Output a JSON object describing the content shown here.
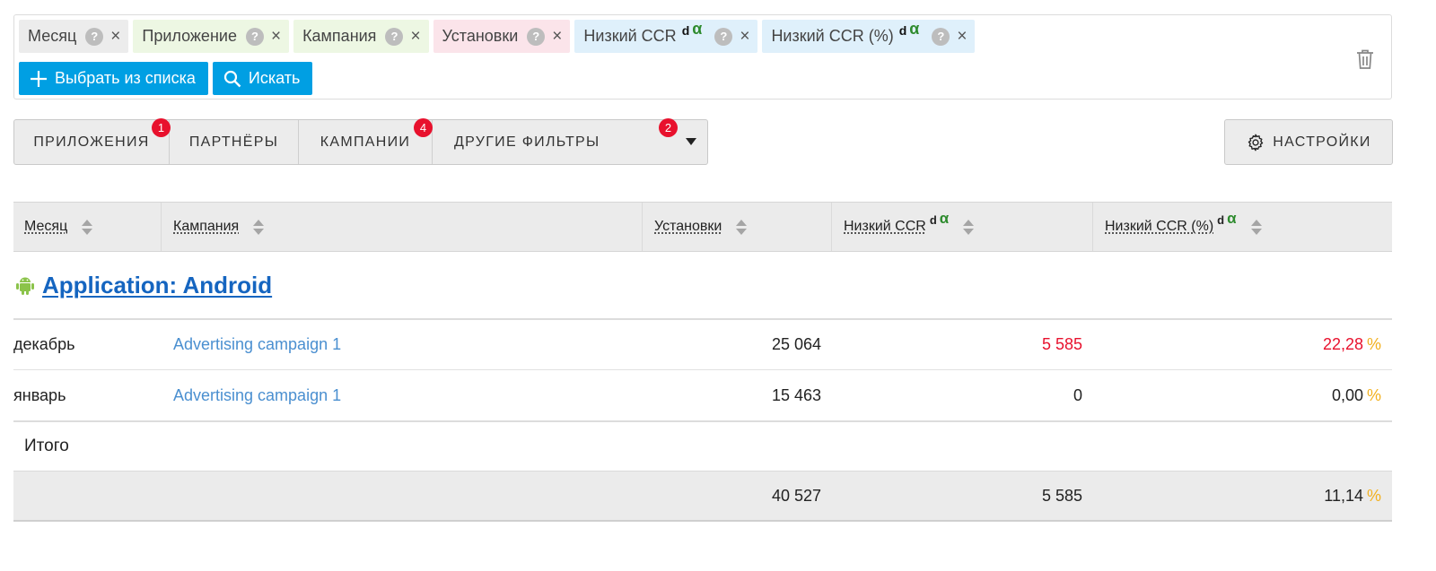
{
  "filters": {
    "chips": [
      {
        "label": "Месяц",
        "sup": "",
        "alpha": "",
        "color": "#ececec"
      },
      {
        "label": "Приложение",
        "sup": "",
        "alpha": "",
        "color": "#edf7e3"
      },
      {
        "label": "Кампания",
        "sup": "",
        "alpha": "",
        "color": "#edf7e3"
      },
      {
        "label": "Установки",
        "sup": "",
        "alpha": "",
        "color": "#fbe4ea"
      },
      {
        "label": "Низкий CCR",
        "sup": "d",
        "alpha": "α",
        "color": "#dff0fb"
      },
      {
        "label": "Низкий CCR (%)",
        "sup": "d",
        "alpha": "α",
        "color": "#dff0fb"
      }
    ],
    "help_glyph": "?",
    "remove_glyph": "×",
    "select_button": "Выбрать из списка",
    "search_button": "Искать"
  },
  "tabs": [
    {
      "label": "ПРИЛОЖЕНИЯ",
      "badge": "1"
    },
    {
      "label": "ПАРТНЁРЫ",
      "badge": ""
    },
    {
      "label": "КАМПАНИИ",
      "badge": "4"
    },
    {
      "label": "ДРУГИЕ ФИЛЬТРЫ",
      "badge": "2"
    }
  ],
  "settings_button": "НАСТРОЙКИ",
  "table": {
    "columns": [
      {
        "label": "Месяц",
        "sup": "",
        "alpha": ""
      },
      {
        "label": "Кампания",
        "sup": "",
        "alpha": ""
      },
      {
        "label": "Установки",
        "sup": "",
        "alpha": ""
      },
      {
        "label": "Низкий CCR",
        "sup": "d",
        "alpha": "α"
      },
      {
        "label": "Низкий CCR (%)",
        "sup": "d",
        "alpha": "α"
      }
    ],
    "group_title": "Application: Android",
    "rows": [
      {
        "month": "декабрь",
        "campaign": "Advertising campaign 1",
        "installs": "25 064",
        "low_ccr": "5 585",
        "low_ccr_pct": "22,28",
        "highlight": true
      },
      {
        "month": "январь",
        "campaign": "Advertising campaign 1",
        "installs": "15 463",
        "low_ccr": "0",
        "low_ccr_pct": "0,00",
        "highlight": false
      }
    ],
    "percent_sign": "%",
    "total_label": "Итого",
    "total": {
      "installs": "40 527",
      "low_ccr": "5 585",
      "low_ccr_pct": "11,14"
    }
  },
  "colors": {
    "accent_blue": "#009fe3",
    "link": "#4a8fd0",
    "group_link": "#1565c0",
    "alert_red": "#e8112d",
    "percent_yellow": "#f2b01e",
    "android_green": "#8bc34a"
  }
}
